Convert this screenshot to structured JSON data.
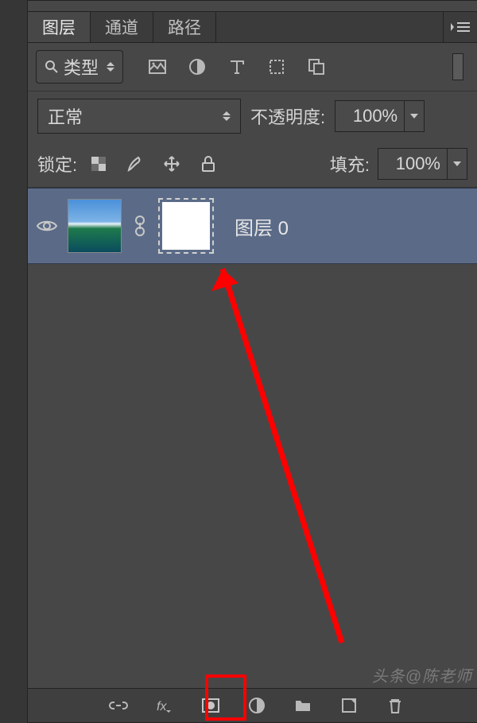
{
  "tabs": {
    "layers": "图层",
    "channels": "通道",
    "paths": "路径"
  },
  "filter": {
    "label": "类型"
  },
  "blend": {
    "mode": "正常",
    "opacity_label": "不透明度:",
    "opacity_value": "100%"
  },
  "lock": {
    "label": "锁定:",
    "fill_label": "填充:",
    "fill_value": "100%"
  },
  "layer0": {
    "name": "图层 0"
  },
  "watermark": "头条@陈老师"
}
